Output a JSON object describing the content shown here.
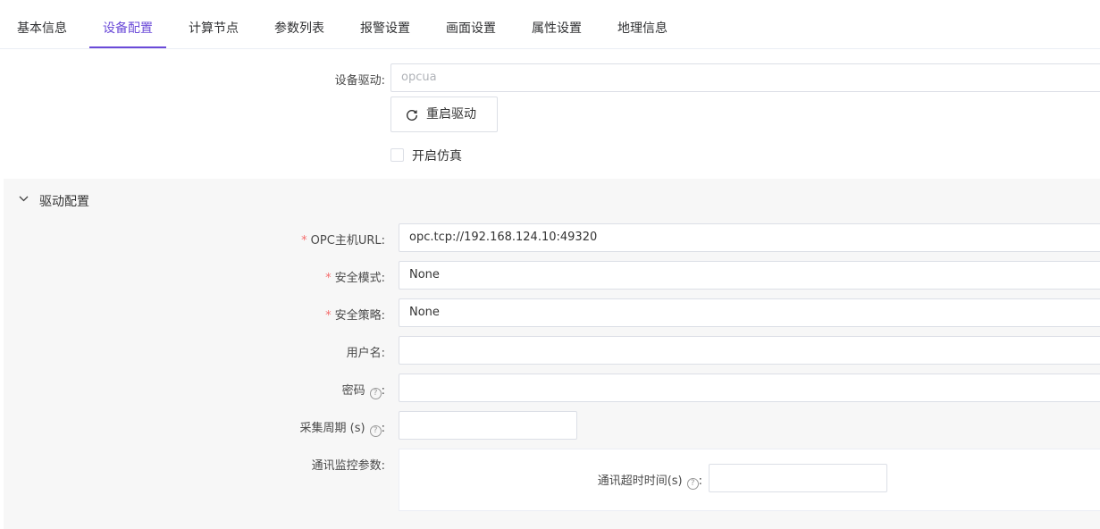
{
  "tabs": [
    {
      "label": "基本信息",
      "active": false
    },
    {
      "label": "设备配置",
      "active": true
    },
    {
      "label": "计算节点",
      "active": false
    },
    {
      "label": "参数列表",
      "active": false
    },
    {
      "label": "报警设置",
      "active": false
    },
    {
      "label": "画面设置",
      "active": false
    },
    {
      "label": "属性设置",
      "active": false
    },
    {
      "label": "地理信息",
      "active": false
    }
  ],
  "device": {
    "driver_label": "设备驱动:",
    "driver_value": "opcua",
    "restart_button": "重启驱动",
    "simulation_label": "开启仿真",
    "simulation_checked": false
  },
  "driver_config": {
    "title": "驱动配置",
    "url_label": "OPC主机URL:",
    "url_value": "opc.tcp://192.168.124.10:49320",
    "security_mode_label": "安全模式:",
    "security_mode_value": "None",
    "security_policy_label": "安全策略:",
    "security_policy_value": "None",
    "username_label": "用户名:",
    "username_value": "",
    "password_label": "密码",
    "password_value": "",
    "period_label": "采集周期 (s)",
    "period_value": "",
    "comm_monitor_label": "通讯监控参数:",
    "timeout_label": "通讯超时时间(s)",
    "timeout_value": ""
  },
  "required_mark": "*",
  "colon": ":",
  "colors": {
    "accent": "#6b4bd8",
    "required": "#f56c6c",
    "border": "#dcdfe6",
    "panel_bg": "#f7f7f7"
  },
  "icons": {
    "restart": "refresh-icon",
    "collapse": "chevron-down-icon",
    "help": "question-circle-icon"
  }
}
